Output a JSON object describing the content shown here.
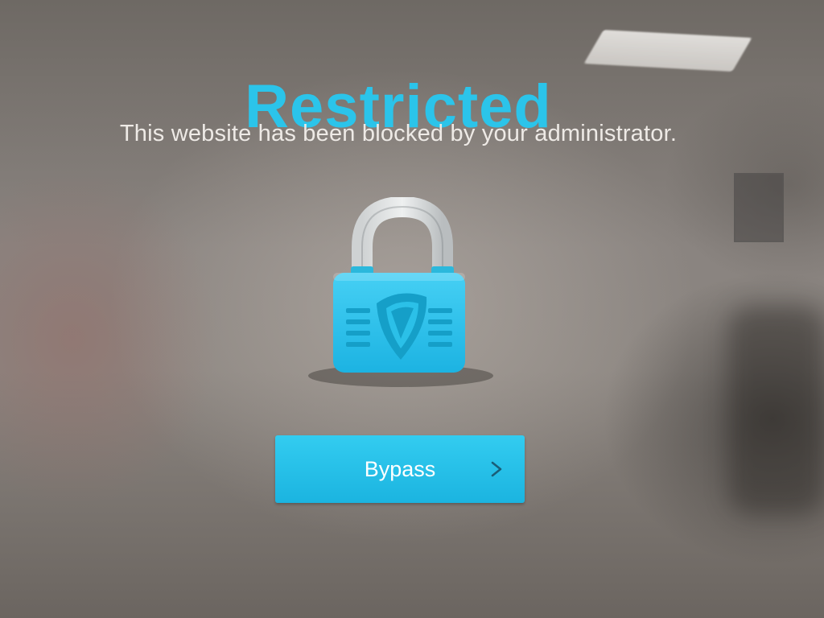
{
  "page": {
    "title": "Restricted",
    "message": "This website has been blocked by your administrator."
  },
  "illustration": {
    "icon": "padlock-shield-icon"
  },
  "bypass_button": {
    "label": "Bypass",
    "icon": "chevron-right-icon"
  },
  "colors": {
    "accent": "#2bc4ea",
    "button": "#1fbbe6",
    "text_light": "#eeeae6"
  }
}
